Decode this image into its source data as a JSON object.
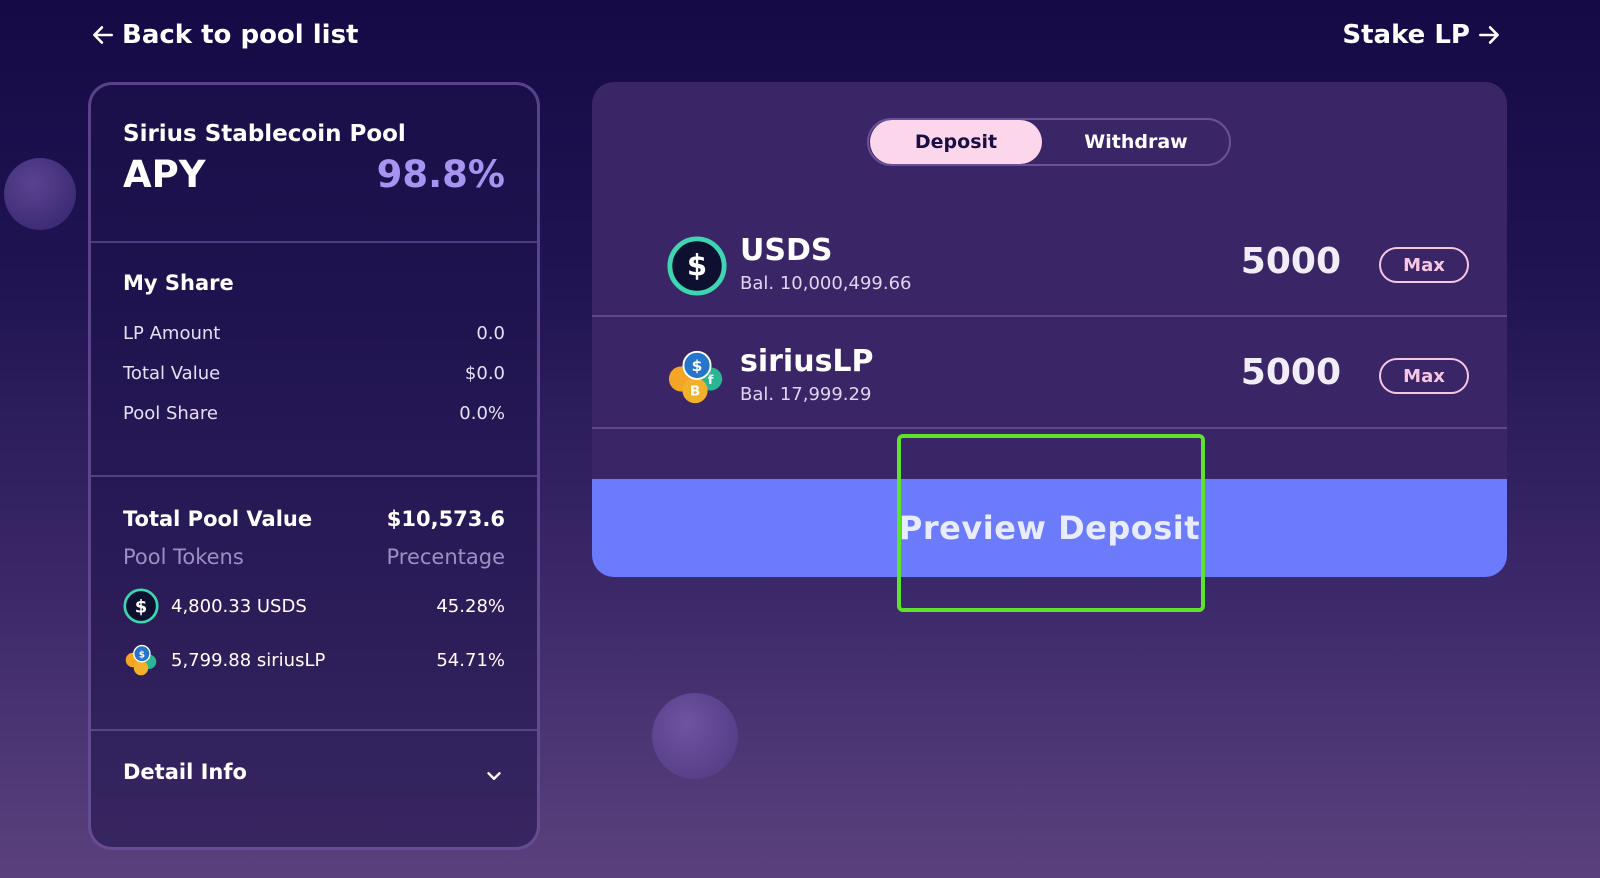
{
  "nav": {
    "back_label": "Back to pool list",
    "stake_label": "Stake LP"
  },
  "pool": {
    "name": "Sirius Stablecoin Pool",
    "apy_label": "APY",
    "apy_value": "98.8%"
  },
  "my_share": {
    "title": "My Share",
    "rows": [
      {
        "label": "LP Amount",
        "value": "0.0"
      },
      {
        "label": "Total Value",
        "value": "$0.0"
      },
      {
        "label": "Pool Share",
        "value": "0.0%"
      }
    ]
  },
  "pool_value": {
    "title": "Total Pool Value",
    "value": "$10,573.6",
    "col_tokens": "Pool Tokens",
    "col_percentage": "Precentage",
    "tokens": [
      {
        "amount": "4,800.33 USDS",
        "percent": "45.28%"
      },
      {
        "amount": "5,799.88 siriusLP",
        "percent": "54.71%"
      }
    ]
  },
  "detail": {
    "title": "Detail Info"
  },
  "tabs": {
    "deposit": "Deposit",
    "withdraw": "Withdraw",
    "active": "Deposit"
  },
  "inputs": [
    {
      "symbol": "USDS",
      "balance": "Bal. 10,000,499.66",
      "amount": "5000",
      "max_label": "Max"
    },
    {
      "symbol": "siriusLP",
      "balance": "Bal. 17,999.29",
      "amount": "5000",
      "max_label": "Max"
    }
  ],
  "preview_button": "Preview Deposit",
  "colors": {
    "accent": "#6b7bfb",
    "apy": "#a794f0",
    "tab_active": "#fcd7ec",
    "highlight": "#5ee32b",
    "max": "#f7c6e2"
  }
}
